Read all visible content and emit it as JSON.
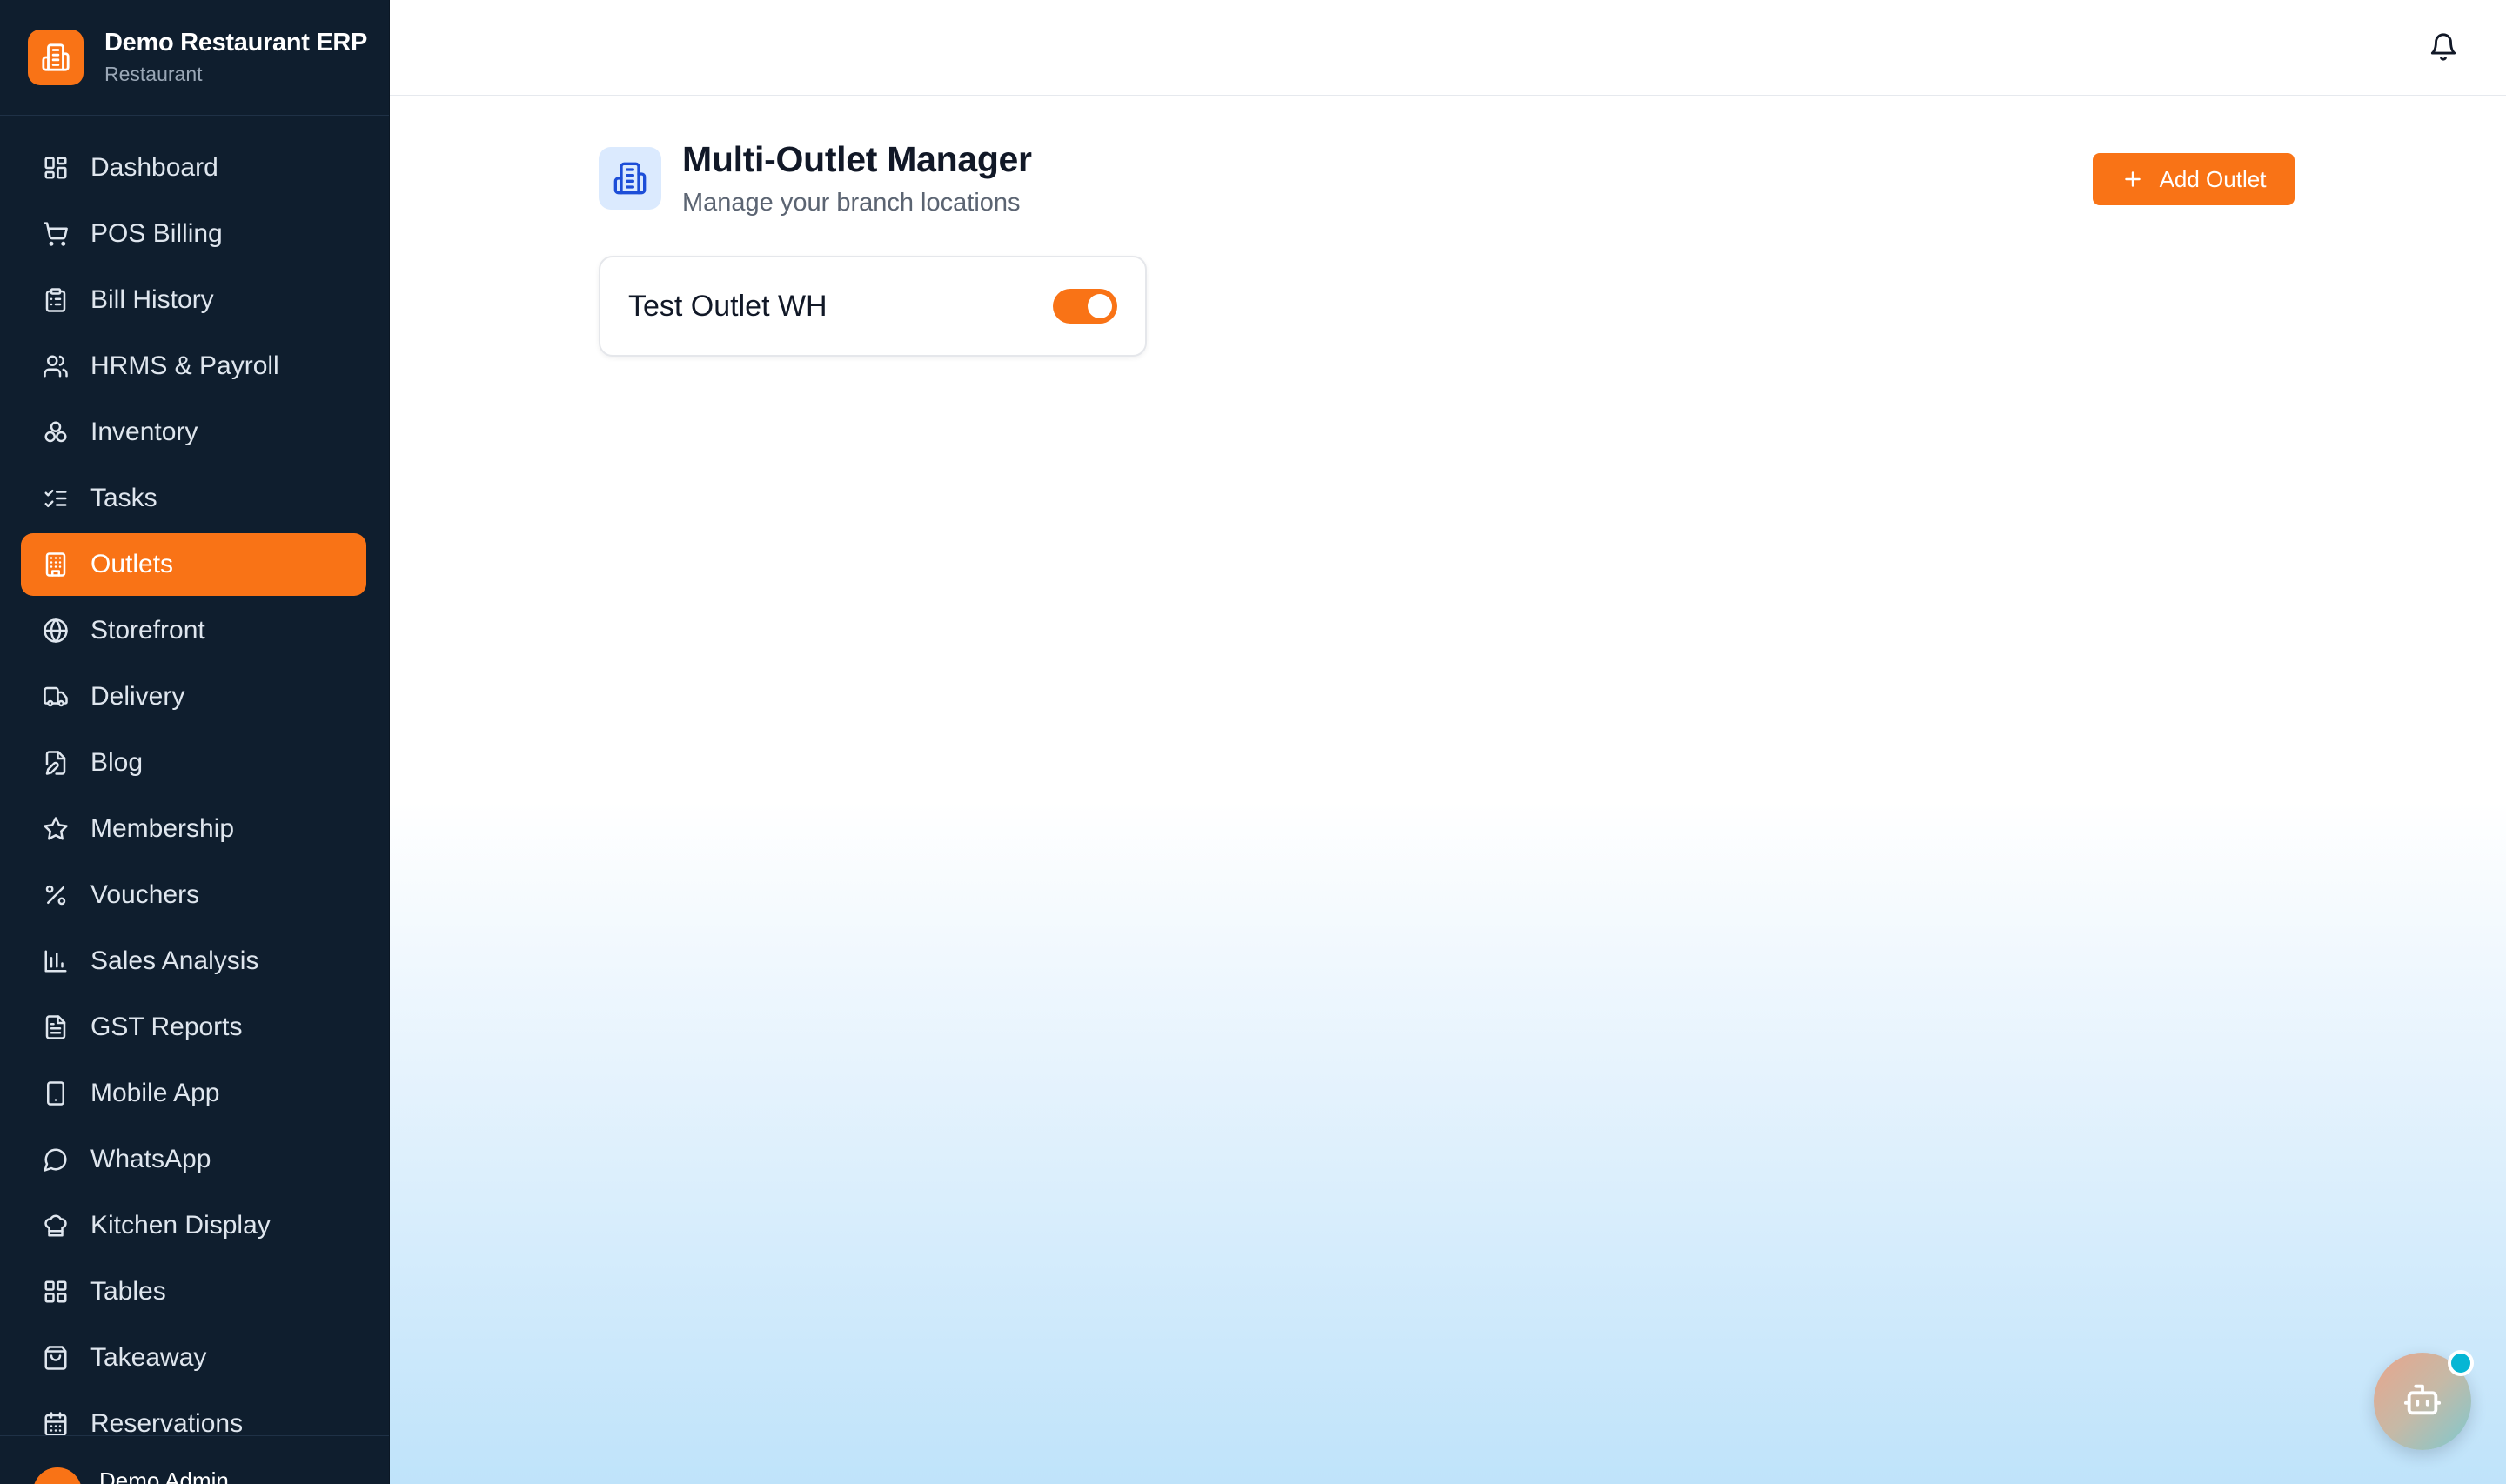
{
  "brand": {
    "name": "Demo Restaurant ERP",
    "subtitle": "Restaurant",
    "logo_icon": "building-icon"
  },
  "sidebar": {
    "items": [
      {
        "label": "Dashboard",
        "icon": "dashboard-grid-icon"
      },
      {
        "label": "POS Billing",
        "icon": "shopping-cart-icon"
      },
      {
        "label": "Bill History",
        "icon": "clipboard-icon"
      },
      {
        "label": "HRMS & Payroll",
        "icon": "users-icon"
      },
      {
        "label": "Inventory",
        "icon": "boxes-icon"
      },
      {
        "label": "Tasks",
        "icon": "checklist-icon"
      },
      {
        "label": "Outlets",
        "icon": "building-icon",
        "active": true
      },
      {
        "label": "Storefront",
        "icon": "globe-icon"
      },
      {
        "label": "Delivery",
        "icon": "truck-icon"
      },
      {
        "label": "Blog",
        "icon": "file-edit-icon"
      },
      {
        "label": "Membership",
        "icon": "star-icon"
      },
      {
        "label": "Vouchers",
        "icon": "percent-icon"
      },
      {
        "label": "Sales Analysis",
        "icon": "bar-chart-icon"
      },
      {
        "label": "GST Reports",
        "icon": "file-text-icon"
      },
      {
        "label": "Mobile App",
        "icon": "smartphone-icon"
      },
      {
        "label": "WhatsApp",
        "icon": "message-circle-icon"
      },
      {
        "label": "Kitchen Display",
        "icon": "chef-hat-icon"
      },
      {
        "label": "Tables",
        "icon": "grid-icon"
      },
      {
        "label": "Takeaway",
        "icon": "shopping-bag-icon"
      },
      {
        "label": "Reservations",
        "icon": "calendar-icon"
      }
    ],
    "footer_user": "Demo Admin"
  },
  "topbar": {
    "notification_icon": "bell-icon"
  },
  "page": {
    "title": "Multi-Outlet Manager",
    "subtitle": "Manage your branch locations",
    "add_button_label": "Add Outlet"
  },
  "outlets": [
    {
      "name": "Test Outlet WH",
      "enabled": true
    }
  ],
  "colors": {
    "accent": "#f97316",
    "sidebar_bg": "#0f1e2e",
    "header_icon_bg": "#dbeafe",
    "header_icon_fg": "#1d4ed8"
  }
}
